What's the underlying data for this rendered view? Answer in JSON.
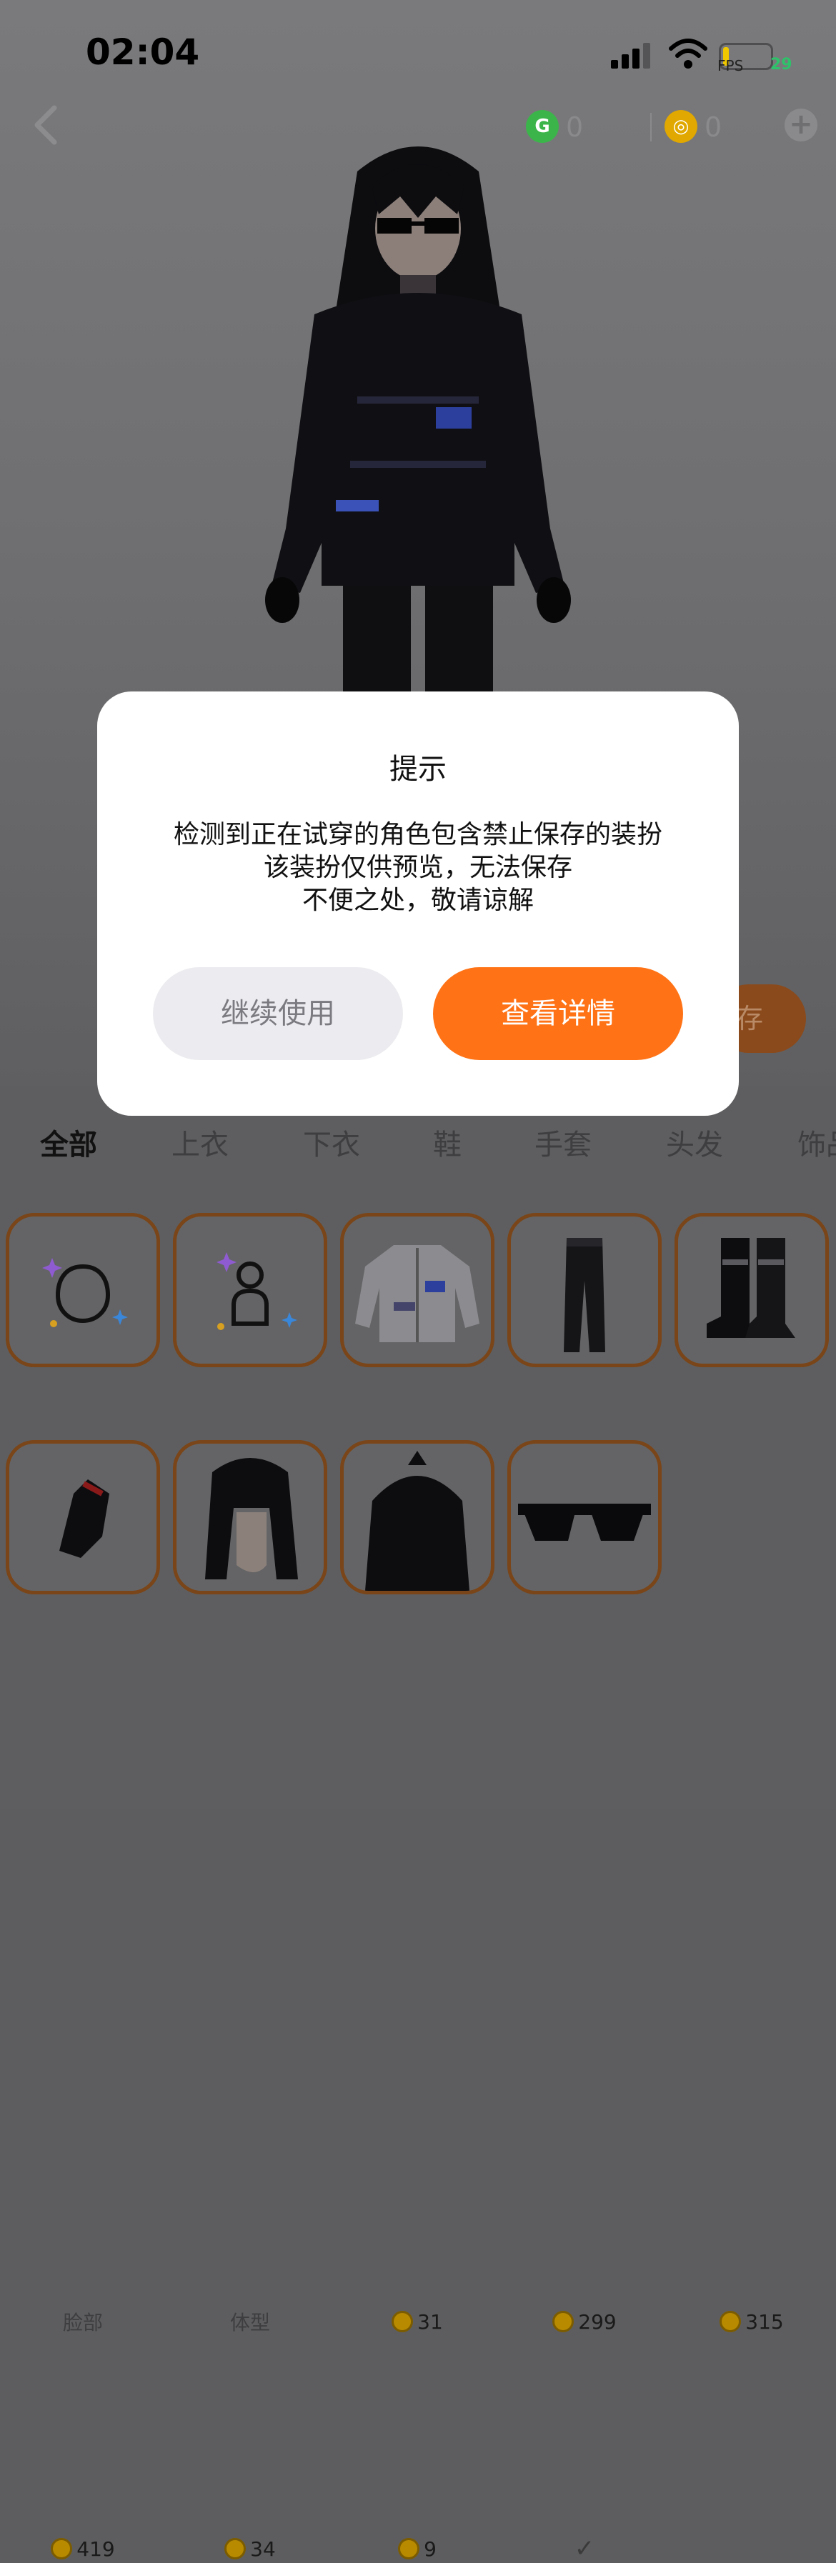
{
  "status_bar": {
    "time": "02:04",
    "fps_label": "FPS",
    "fps_value": "29"
  },
  "header": {
    "g_currency_amount": "0",
    "coin_currency_amount": "0"
  },
  "save_button_label": "存",
  "tabs": [
    "全部",
    "上衣",
    "下衣",
    "鞋",
    "手套",
    "头发",
    "饰品"
  ],
  "active_tab": "全部",
  "items": [
    {
      "name": "face",
      "label": "脸部",
      "price": null
    },
    {
      "name": "body-type",
      "label": "体型",
      "price": null
    },
    {
      "name": "jacket",
      "label": null,
      "price": "31"
    },
    {
      "name": "pants",
      "label": null,
      "price": "299"
    },
    {
      "name": "boots",
      "label": null,
      "price": "315"
    },
    {
      "name": "gloves",
      "label": null,
      "price": "419"
    },
    {
      "name": "hair-long",
      "label": null,
      "price": "34"
    },
    {
      "name": "hair-short",
      "label": null,
      "price": "9"
    },
    {
      "name": "sunglasses",
      "label": null,
      "price": null,
      "owned": true
    }
  ],
  "dialog": {
    "title": "提示",
    "line1": "检测到正在试穿的角色包含禁止保存的装扮",
    "line2": "该装扮仅供预览，无法保存",
    "line3": "不便之处，敬请谅解",
    "continue_label": "继续使用",
    "detail_label": "查看详情"
  },
  "colors": {
    "accent": "#ff7316",
    "dialog_bg": "#ffffff",
    "secondary_button": "#ececf0"
  }
}
